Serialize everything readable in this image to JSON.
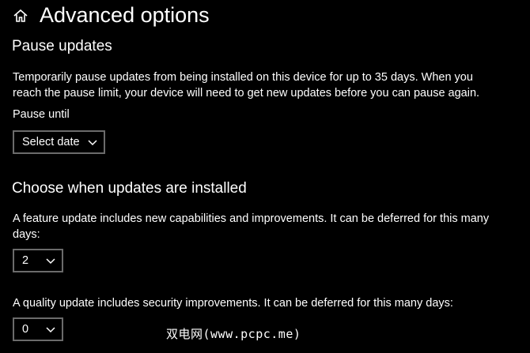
{
  "header": {
    "home_icon": "home-icon",
    "title": "Advanced options"
  },
  "pause_updates": {
    "title": "Pause updates",
    "description_line1": "Temporarily pause updates from being installed on this device for up to 35 days. When you",
    "description_line2": "reach the pause limit, your device will need to get new updates before you can pause again.",
    "pause_until_label": "Pause until",
    "select_date_value": "Select date"
  },
  "choose_when": {
    "title": "Choose when updates are installed",
    "feature_text_line1": "A feature update includes new capabilities and improvements. It can be deferred for this many",
    "feature_text_line2": "days:",
    "feature_value": "2",
    "quality_text": "A quality update includes security improvements. It can be deferred for this many days:",
    "quality_value": "0"
  },
  "watermark": "双电网(www.pcpc.me)",
  "colors": {
    "background": "#000000",
    "text": "#ffffff",
    "dropdown_border": "#6b6b6b"
  }
}
